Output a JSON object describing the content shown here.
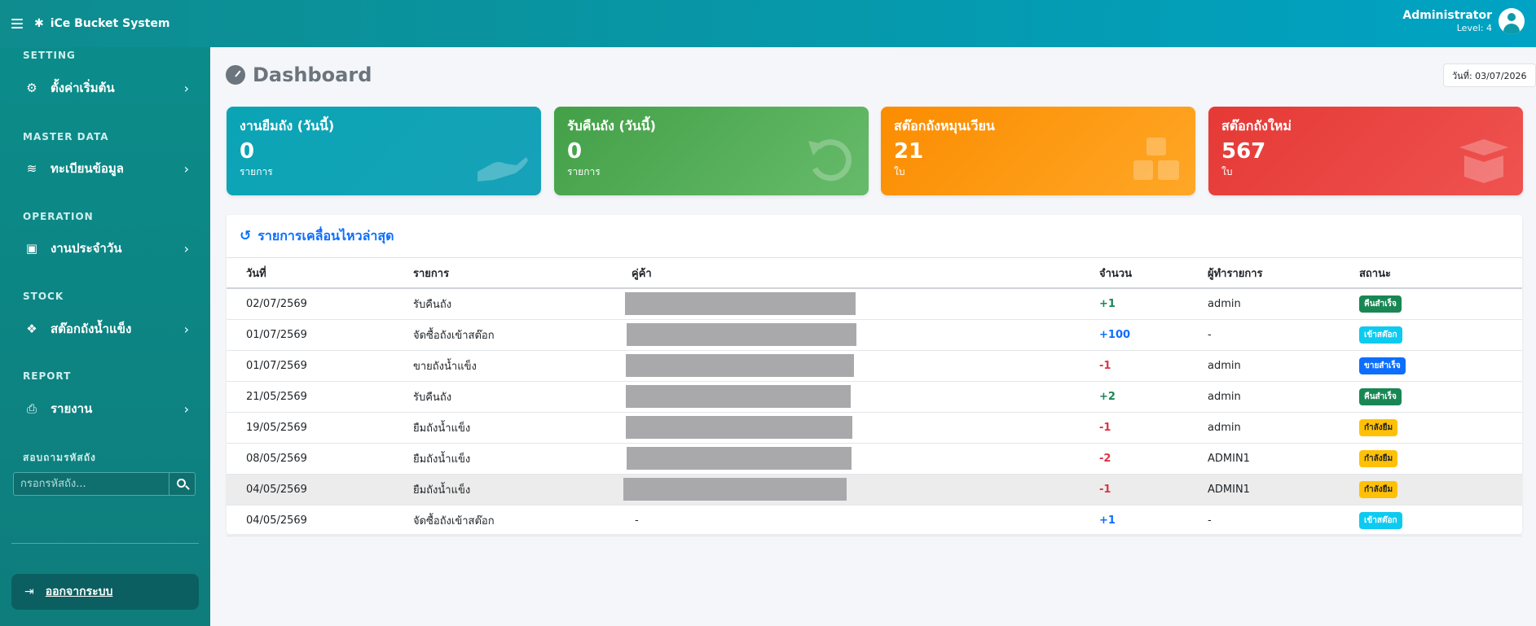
{
  "topbar": {
    "brand": "iCe Bucket System",
    "user_name": "Administrator",
    "user_level": "Level: 4"
  },
  "sidebar": {
    "sections": [
      {
        "heading": "SETTING",
        "item": "ตั้งค่าเริ่มต้น",
        "icon": "gears-icon"
      },
      {
        "heading": "MASTER DATA",
        "item": "ทะเบียนข้อมูล",
        "icon": "database-icon"
      },
      {
        "heading": "OPERATION",
        "item": "งานประจำวัน",
        "icon": "calendar-check-icon"
      },
      {
        "heading": "STOCK",
        "item": "สต๊อกถังน้ำแข็ง",
        "icon": "cubes-icon"
      },
      {
        "heading": "REPORT",
        "item": "รายงาน",
        "icon": "print-icon"
      }
    ],
    "search_heading": "สอบถามรหัสถัง",
    "search_placeholder": "กรอกรหัสถัง...",
    "logout_label": "ออกจากระบบ"
  },
  "main": {
    "title": "Dashboard",
    "date_label": "วันที่: 03/07/2026",
    "cards": [
      {
        "title": "งานยืมถัง (วันนี้)",
        "value": "0",
        "unit": "รายการ",
        "icon": "hand-icon",
        "color": "#0aa4b5"
      },
      {
        "title": "รับคืนถัง (วันนี้)",
        "value": "0",
        "unit": "รายการ",
        "icon": "undo-icon",
        "color": "#43a047"
      },
      {
        "title": "สต๊อกถังหมุนเวียน",
        "value": "21",
        "unit": "ใบ",
        "icon": "cubes-icon",
        "color": "#fb8c00"
      },
      {
        "title": "สต๊อกถังใหม่",
        "value": "567",
        "unit": "ใบ",
        "icon": "box-open-icon",
        "color": "#e53935"
      }
    ],
    "recent": {
      "title": "รายการเคลื่อนไหวล่าสุด",
      "columns": [
        "วันที่",
        "รายการ",
        "คู่ค้า",
        "จำนวน",
        "ผู้ทำรายการ",
        "สถานะ"
      ],
      "rows": [
        {
          "date": "02/07/2569",
          "item": "รับคืนถัง",
          "partner": "",
          "qty": "+1",
          "qty_kind": "green",
          "by": "admin",
          "status": "คืนสำเร็จ",
          "status_kind": "success"
        },
        {
          "date": "01/07/2569",
          "item": "จัดซื้อถังเข้าสต๊อก",
          "partner": "",
          "qty": "+100",
          "qty_kind": "blue",
          "by": "-",
          "status": "เข้าสต๊อก",
          "status_kind": "info"
        },
        {
          "date": "01/07/2569",
          "item": "ขายถังน้ำแข็ง",
          "partner": "",
          "qty": "-1",
          "qty_kind": "red",
          "by": "admin",
          "status": "ขายสำเร็จ",
          "status_kind": "primary"
        },
        {
          "date": "21/05/2569",
          "item": "รับคืนถัง",
          "partner": "",
          "qty": "+2",
          "qty_kind": "green",
          "by": "admin",
          "status": "คืนสำเร็จ",
          "status_kind": "success"
        },
        {
          "date": "19/05/2569",
          "item": "ยืมถังน้ำแข็ง",
          "partner": "",
          "qty": "-1",
          "qty_kind": "red",
          "by": "admin",
          "status": "กำลังยืม",
          "status_kind": "warning"
        },
        {
          "date": "08/05/2569",
          "item": "ยืมถังน้ำแข็ง",
          "partner": "",
          "qty": "-2",
          "qty_kind": "red",
          "by": "ADMIN1",
          "status": "กำลังยืม",
          "status_kind": "warning"
        },
        {
          "date": "04/05/2569",
          "item": "ยืมถังน้ำแข็ง",
          "partner": "",
          "qty": "-1",
          "qty_kind": "red",
          "by": "ADMIN1",
          "status": "กำลังยืม",
          "status_kind": "warning"
        },
        {
          "date": "04/05/2569",
          "item": "จัดซื้อถังเข้าสต๊อก",
          "partner": "-",
          "qty": "+1",
          "qty_kind": "blue",
          "by": "-",
          "status": "เข้าสต๊อก",
          "status_kind": "info"
        }
      ]
    }
  }
}
